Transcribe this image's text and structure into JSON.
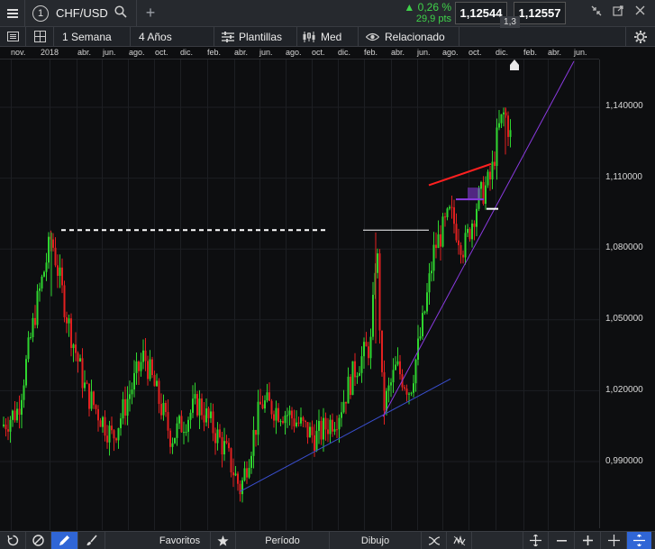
{
  "topbar": {
    "window_number": "1",
    "symbol": "CHF/USD",
    "change_pct": "0,26 %",
    "change_pts": "29,9 pts",
    "bid": "1,12544",
    "ask": "1,12557",
    "spread": "1,3"
  },
  "toolbar": {
    "period": "1 Semana",
    "range": "4 Años",
    "templates": "Plantillas",
    "price_type": "Med",
    "related": "Relacionado"
  },
  "time_axis": [
    "nov.",
    "2018",
    "abr.",
    "jun.",
    "ago.",
    "oct.",
    "dic.",
    "feb.",
    "abr.",
    "jun.",
    "ago.",
    "oct.",
    "dic.",
    "feb.",
    "abr.",
    "jun.",
    "ago.",
    "oct.",
    "dic.",
    "feb.",
    "abr.",
    "jun."
  ],
  "price_axis": [
    "1,140000",
    "1,110000",
    "1,080000",
    "1,050000",
    "1,020000",
    "0,990000"
  ],
  "bottombar": {
    "favorites": "Favoritos",
    "period": "Período",
    "drawing": "Dibujo"
  },
  "colors": {
    "up": "#2fd52f",
    "down": "#e22020",
    "trendline_blue": "#3a4fd0",
    "trendline_purple": "#8a3ae0",
    "active_tool": "#3066d6"
  },
  "chart_data": {
    "type": "candlestick",
    "instrument": "CHF/USD",
    "timeframe": "1 Semana",
    "ylim": [
      0.97,
      1.155
    ],
    "y_ticks": [
      1.14,
      1.11,
      1.08,
      1.05,
      1.02,
      0.99
    ],
    "key_levels": {
      "start_2018_low": 1.005,
      "peak_2018": 1.087,
      "low_2019": 0.978,
      "high_mar_2020": 1.087,
      "low_mar_2020": 1.009,
      "high_2020": 1.14,
      "last": 1.1255
    }
  }
}
